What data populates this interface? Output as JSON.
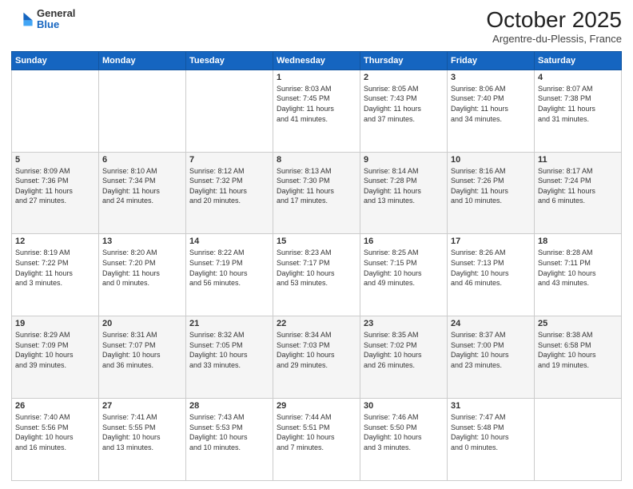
{
  "header": {
    "logo_general": "General",
    "logo_blue": "Blue",
    "title": "October 2025",
    "location": "Argentre-du-Plessis, France"
  },
  "days_of_week": [
    "Sunday",
    "Monday",
    "Tuesday",
    "Wednesday",
    "Thursday",
    "Friday",
    "Saturday"
  ],
  "weeks": [
    {
      "cells": [
        {
          "day": "",
          "content": ""
        },
        {
          "day": "",
          "content": ""
        },
        {
          "day": "",
          "content": ""
        },
        {
          "day": "1",
          "content": "Sunrise: 8:03 AM\nSunset: 7:45 PM\nDaylight: 11 hours\nand 41 minutes."
        },
        {
          "day": "2",
          "content": "Sunrise: 8:05 AM\nSunset: 7:43 PM\nDaylight: 11 hours\nand 37 minutes."
        },
        {
          "day": "3",
          "content": "Sunrise: 8:06 AM\nSunset: 7:40 PM\nDaylight: 11 hours\nand 34 minutes."
        },
        {
          "day": "4",
          "content": "Sunrise: 8:07 AM\nSunset: 7:38 PM\nDaylight: 11 hours\nand 31 minutes."
        }
      ]
    },
    {
      "cells": [
        {
          "day": "5",
          "content": "Sunrise: 8:09 AM\nSunset: 7:36 PM\nDaylight: 11 hours\nand 27 minutes."
        },
        {
          "day": "6",
          "content": "Sunrise: 8:10 AM\nSunset: 7:34 PM\nDaylight: 11 hours\nand 24 minutes."
        },
        {
          "day": "7",
          "content": "Sunrise: 8:12 AM\nSunset: 7:32 PM\nDaylight: 11 hours\nand 20 minutes."
        },
        {
          "day": "8",
          "content": "Sunrise: 8:13 AM\nSunset: 7:30 PM\nDaylight: 11 hours\nand 17 minutes."
        },
        {
          "day": "9",
          "content": "Sunrise: 8:14 AM\nSunset: 7:28 PM\nDaylight: 11 hours\nand 13 minutes."
        },
        {
          "day": "10",
          "content": "Sunrise: 8:16 AM\nSunset: 7:26 PM\nDaylight: 11 hours\nand 10 minutes."
        },
        {
          "day": "11",
          "content": "Sunrise: 8:17 AM\nSunset: 7:24 PM\nDaylight: 11 hours\nand 6 minutes."
        }
      ]
    },
    {
      "cells": [
        {
          "day": "12",
          "content": "Sunrise: 8:19 AM\nSunset: 7:22 PM\nDaylight: 11 hours\nand 3 minutes."
        },
        {
          "day": "13",
          "content": "Sunrise: 8:20 AM\nSunset: 7:20 PM\nDaylight: 11 hours\nand 0 minutes."
        },
        {
          "day": "14",
          "content": "Sunrise: 8:22 AM\nSunset: 7:19 PM\nDaylight: 10 hours\nand 56 minutes."
        },
        {
          "day": "15",
          "content": "Sunrise: 8:23 AM\nSunset: 7:17 PM\nDaylight: 10 hours\nand 53 minutes."
        },
        {
          "day": "16",
          "content": "Sunrise: 8:25 AM\nSunset: 7:15 PM\nDaylight: 10 hours\nand 49 minutes."
        },
        {
          "day": "17",
          "content": "Sunrise: 8:26 AM\nSunset: 7:13 PM\nDaylight: 10 hours\nand 46 minutes."
        },
        {
          "day": "18",
          "content": "Sunrise: 8:28 AM\nSunset: 7:11 PM\nDaylight: 10 hours\nand 43 minutes."
        }
      ]
    },
    {
      "cells": [
        {
          "day": "19",
          "content": "Sunrise: 8:29 AM\nSunset: 7:09 PM\nDaylight: 10 hours\nand 39 minutes."
        },
        {
          "day": "20",
          "content": "Sunrise: 8:31 AM\nSunset: 7:07 PM\nDaylight: 10 hours\nand 36 minutes."
        },
        {
          "day": "21",
          "content": "Sunrise: 8:32 AM\nSunset: 7:05 PM\nDaylight: 10 hours\nand 33 minutes."
        },
        {
          "day": "22",
          "content": "Sunrise: 8:34 AM\nSunset: 7:03 PM\nDaylight: 10 hours\nand 29 minutes."
        },
        {
          "day": "23",
          "content": "Sunrise: 8:35 AM\nSunset: 7:02 PM\nDaylight: 10 hours\nand 26 minutes."
        },
        {
          "day": "24",
          "content": "Sunrise: 8:37 AM\nSunset: 7:00 PM\nDaylight: 10 hours\nand 23 minutes."
        },
        {
          "day": "25",
          "content": "Sunrise: 8:38 AM\nSunset: 6:58 PM\nDaylight: 10 hours\nand 19 minutes."
        }
      ]
    },
    {
      "cells": [
        {
          "day": "26",
          "content": "Sunrise: 7:40 AM\nSunset: 5:56 PM\nDaylight: 10 hours\nand 16 minutes."
        },
        {
          "day": "27",
          "content": "Sunrise: 7:41 AM\nSunset: 5:55 PM\nDaylight: 10 hours\nand 13 minutes."
        },
        {
          "day": "28",
          "content": "Sunrise: 7:43 AM\nSunset: 5:53 PM\nDaylight: 10 hours\nand 10 minutes."
        },
        {
          "day": "29",
          "content": "Sunrise: 7:44 AM\nSunset: 5:51 PM\nDaylight: 10 hours\nand 7 minutes."
        },
        {
          "day": "30",
          "content": "Sunrise: 7:46 AM\nSunset: 5:50 PM\nDaylight: 10 hours\nand 3 minutes."
        },
        {
          "day": "31",
          "content": "Sunrise: 7:47 AM\nSunset: 5:48 PM\nDaylight: 10 hours\nand 0 minutes."
        },
        {
          "day": "",
          "content": ""
        }
      ]
    }
  ]
}
